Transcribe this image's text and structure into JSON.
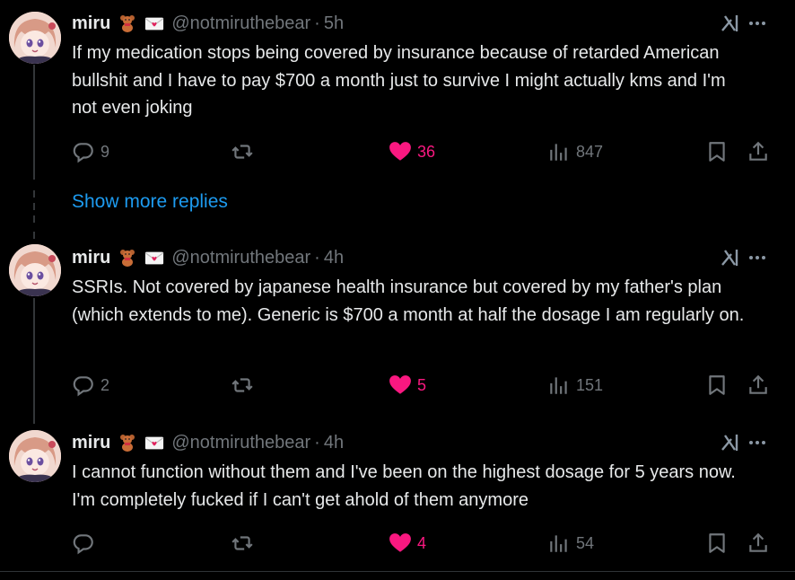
{
  "tweets": [
    {
      "name": "miru",
      "handle": "@notmiruthebear",
      "sep": "·",
      "time": "5h",
      "text": "If my medication stops being covered by insurance because of retarded American bullshit and I have to pay $700 a month just to survive I might actually kms and I'm not even joking",
      "replies": "9",
      "reposts": "",
      "likes": "36",
      "views": "847"
    },
    {
      "name": "miru",
      "handle": "@notmiruthebear",
      "sep": "·",
      "time": "4h",
      "text": "SSRIs. Not covered by japanese health insurance but covered by my father's plan (which extends to me). Generic is $700 a month at half the dosage I am regularly on.",
      "replies": "2",
      "reposts": "",
      "likes": "5",
      "views": "151"
    },
    {
      "name": "miru",
      "handle": "@notmiruthebear",
      "sep": "·",
      "time": "4h",
      "text": "I cannot function without them and I've been on the highest dosage for 5 years now. I'm completely fucked if I can't get ahold of them anymore",
      "replies": "",
      "reposts": "",
      "likes": "4",
      "views": "54"
    }
  ],
  "show_more_replies": "Show more replies",
  "colors": {
    "background": "#000000",
    "text": "#e7e9ea",
    "muted": "#71767b",
    "like": "#f91880",
    "link": "#1d9bf0"
  }
}
